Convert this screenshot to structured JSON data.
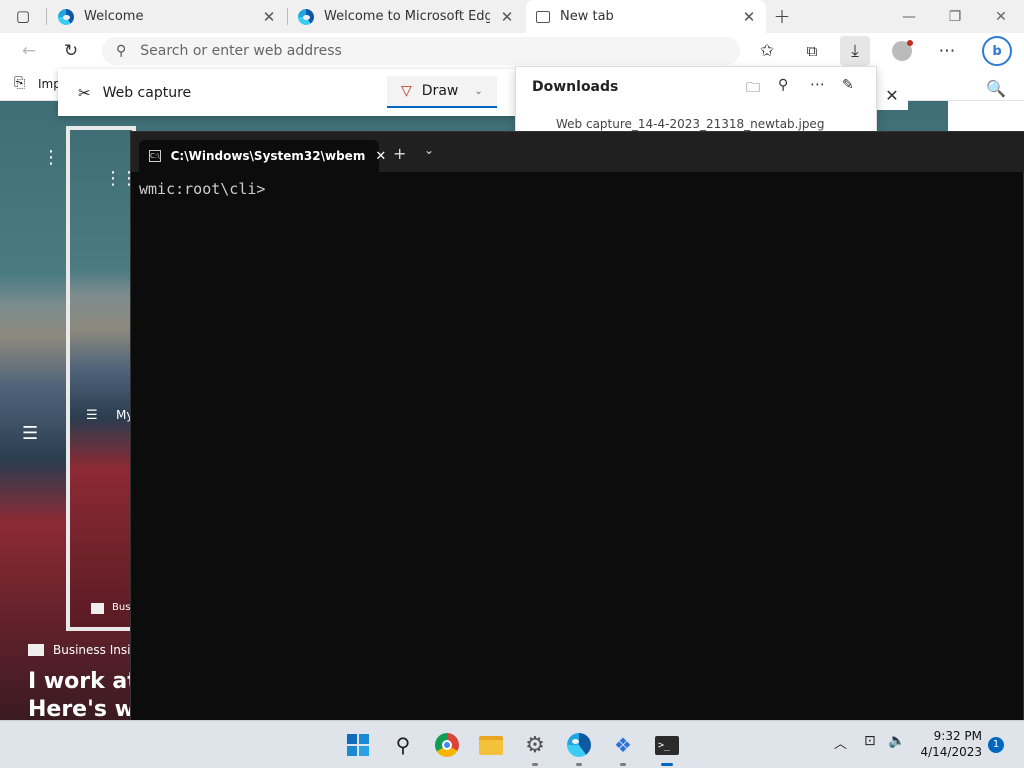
{
  "browser": {
    "tabs": [
      {
        "label": "Welcome",
        "icon": "edge-icon"
      },
      {
        "label": "Welcome to Microsoft Edge",
        "icon": "edge-icon"
      },
      {
        "label": "New tab",
        "icon": "new-tab-icon"
      }
    ],
    "new_tab_label": "+",
    "address_placeholder": "Search or enter web address",
    "favorites_label": "Imp"
  },
  "web_capture": {
    "title": "Web capture",
    "draw_label": "Draw"
  },
  "downloads": {
    "title": "Downloads",
    "item": "Web capture_14-4-2023_21318_newtab.jpeg"
  },
  "background_page": {
    "source_badge": "Business Inside",
    "source_badge_2": "Bus",
    "headline_1": "I work at",
    "headline_2": "Here's wh",
    "nav_label": "My"
  },
  "terminal": {
    "tab_title": "C:\\Windows\\System32\\wbem",
    "prompt": "wmic:root\\cli>"
  },
  "taskbar": {
    "time": "9:32 PM",
    "date": "4/14/2023",
    "notification_count": "1"
  }
}
